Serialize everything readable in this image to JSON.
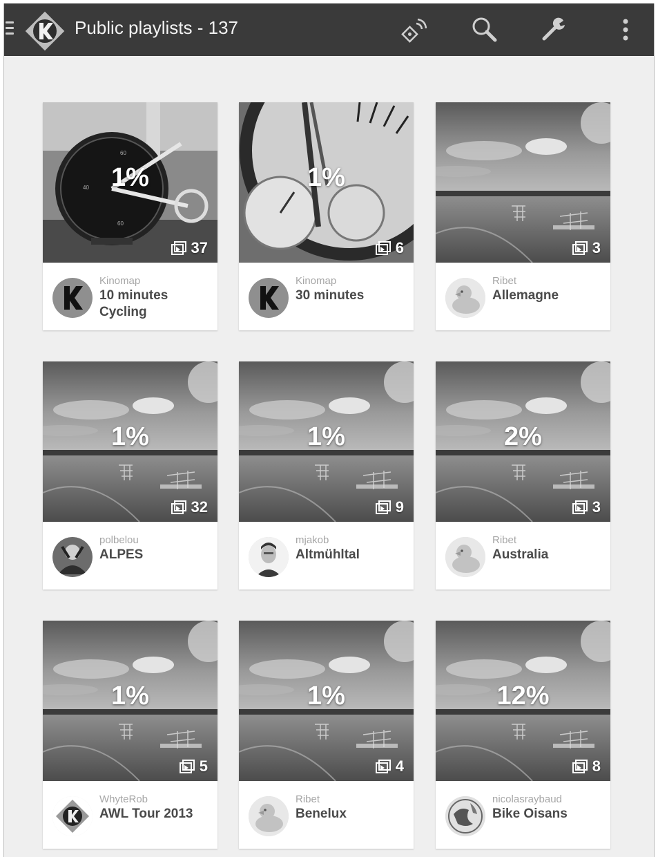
{
  "appbar": {
    "title": "Public playlists - 137",
    "icons": [
      "menu-icon",
      "kinomap-logo",
      "cast-icon",
      "search-icon",
      "wrench-icon",
      "more-vert-icon"
    ]
  },
  "playlists": [
    {
      "percent": "1%",
      "count": "37",
      "author": "Kinomap",
      "name": "10 minutes Cycling",
      "image": "speedometer",
      "avatar": "kinomap"
    },
    {
      "percent": "1%",
      "count": "6",
      "author": "Kinomap",
      "name": "30 minutes",
      "image": "watch",
      "avatar": "kinomap"
    },
    {
      "percent": "",
      "count": "3",
      "author": "Ribet",
      "name": "Allemagne",
      "image": "lake",
      "avatar": "duck"
    },
    {
      "percent": "1%",
      "count": "32",
      "author": "polbelou",
      "name": "ALPES",
      "image": "lake",
      "avatar": "person-dark"
    },
    {
      "percent": "1%",
      "count": "9",
      "author": "mjakob",
      "name": "Altmühltal",
      "image": "lake",
      "avatar": "person-light"
    },
    {
      "percent": "2%",
      "count": "3",
      "author": "Ribet",
      "name": "Australia",
      "image": "lake",
      "avatar": "duck"
    },
    {
      "percent": "1%",
      "count": "5",
      "author": "WhyteRob",
      "name": "AWL Tour 2013",
      "image": "lake",
      "avatar": "kinomap-diamond"
    },
    {
      "percent": "1%",
      "count": "4",
      "author": "Ribet",
      "name": "Benelux",
      "image": "lake",
      "avatar": "duck"
    },
    {
      "percent": "12%",
      "count": "8",
      "author": "nicolasraybaud",
      "name": "Bike Oisans",
      "image": "lake",
      "avatar": "globe"
    }
  ],
  "colors": {
    "appbar": "#3a3a3a",
    "background": "#efefef",
    "card": "#ffffff",
    "author_text": "#a6a6a6",
    "name_text": "#4a4a4a"
  }
}
